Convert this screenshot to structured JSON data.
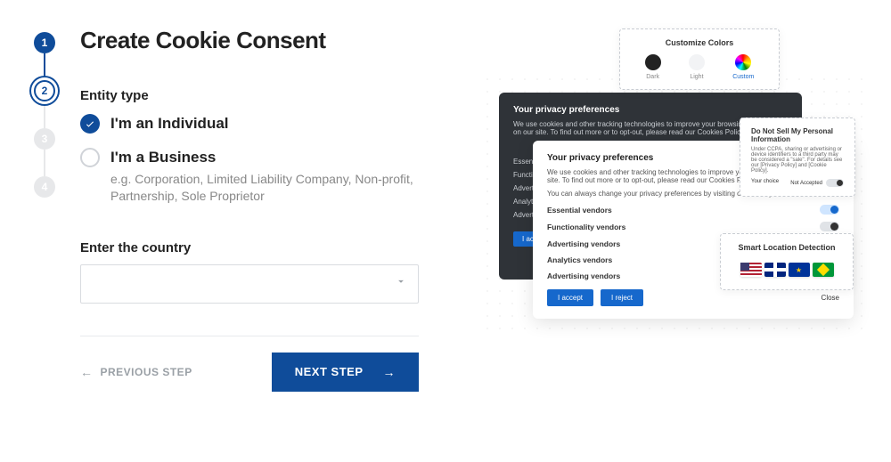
{
  "header": {
    "title": "Create Cookie Consent"
  },
  "stepper": {
    "steps": [
      "1",
      "2",
      "3",
      "4"
    ],
    "current_index": 1
  },
  "form": {
    "entity_label": "Entity type",
    "option_individual": "I'm an Individual",
    "option_business": "I'm a Business",
    "business_sub": "e.g. Corporation, Limited Liability Company, Non-profit, Partnership, Sole Proprietor",
    "country_label": "Enter the country",
    "country_value": ""
  },
  "actions": {
    "prev": "PREVIOUS STEP",
    "next": "NEXT STEP"
  },
  "preview": {
    "colors_card": {
      "title": "Customize Colors",
      "options": [
        "Dark",
        "Light",
        "Custom"
      ],
      "selected": "Custom"
    },
    "dark_panel": {
      "title": "Your privacy preferences",
      "body": "We use cookies and other tracking technologies to improve your browsing experience on our site. To find out more or to opt-out, please read our Cookies Policy.",
      "rows": [
        "Essential",
        "Functionality",
        "Advertising",
        "Analytics",
        "Advertising"
      ],
      "accept": "I accept"
    },
    "light_panel": {
      "title": "Your privacy preferences",
      "body1": "We use cookies and other tracking technologies to improve your browsing experience on our site. To find out more or to opt-out, please read our Cookies Policy.",
      "body2": "You can always change your privacy preferences by visiting our Privacy Preferences.",
      "vendors": [
        {
          "name": "Essential vendors",
          "on": true
        },
        {
          "name": "Functionality vendors",
          "on": false
        },
        {
          "name": "Advertising vendors",
          "on": false
        },
        {
          "name": "Analytics vendors",
          "on": null
        },
        {
          "name": "Advertising vendors",
          "on": null
        }
      ],
      "accept": "I accept",
      "reject": "I reject",
      "close": "Close"
    },
    "sell_card": {
      "title": "Do Not Sell My Personal Information",
      "body": "Under CCPA, sharing or advertising or device identifiers to a third party may be considered a \"sale\". For details see our [Privacy Policy] and [Cookie Policy].",
      "choice_label": "Your choice",
      "status": "Not Accepted"
    },
    "location_card": {
      "title": "Smart Location Detection",
      "flags": [
        "us",
        "uk",
        "eu",
        "br"
      ]
    }
  }
}
